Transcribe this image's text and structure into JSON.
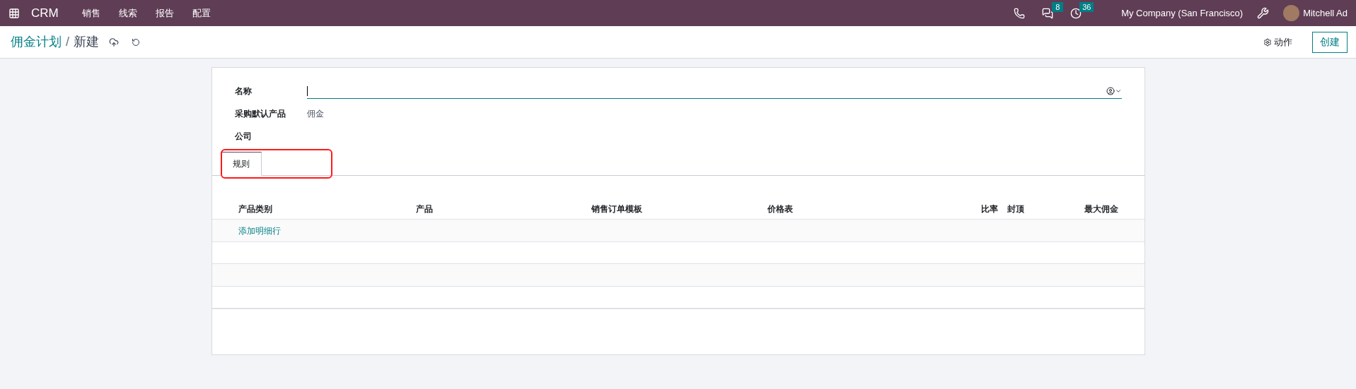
{
  "navbar": {
    "app": "CRM",
    "menu": [
      "销售",
      "线索",
      "报告",
      "配置"
    ],
    "chat_count": "8",
    "activity_count": "36",
    "company": "My Company (San Francisco)",
    "user": "Mitchell Ad"
  },
  "breadcrumb": {
    "parent": "佣金计划",
    "separator": "/",
    "current": "新建"
  },
  "control_panel": {
    "actions": "动作",
    "create": "创建"
  },
  "fields": [
    {
      "label": "名称",
      "kind": "input"
    },
    {
      "label": "采购默认产品",
      "kind": "text",
      "value": "佣金"
    },
    {
      "label": "公司",
      "kind": "text"
    }
  ],
  "tabs": [
    {
      "label": "规则",
      "selected": true
    }
  ],
  "table": {
    "columns": [
      {
        "label": "产品类别",
        "kind": "text"
      },
      {
        "label": "产品",
        "kind": "text"
      },
      {
        "label": "销售订单模板",
        "kind": "text"
      },
      {
        "label": "价格表",
        "kind": "text"
      },
      {
        "label": "比率",
        "kind": "number"
      },
      {
        "label": "封顶",
        "kind": "flag"
      },
      {
        "label": "最大佣金",
        "kind": "number"
      }
    ],
    "add_line": "添加明细行"
  }
}
